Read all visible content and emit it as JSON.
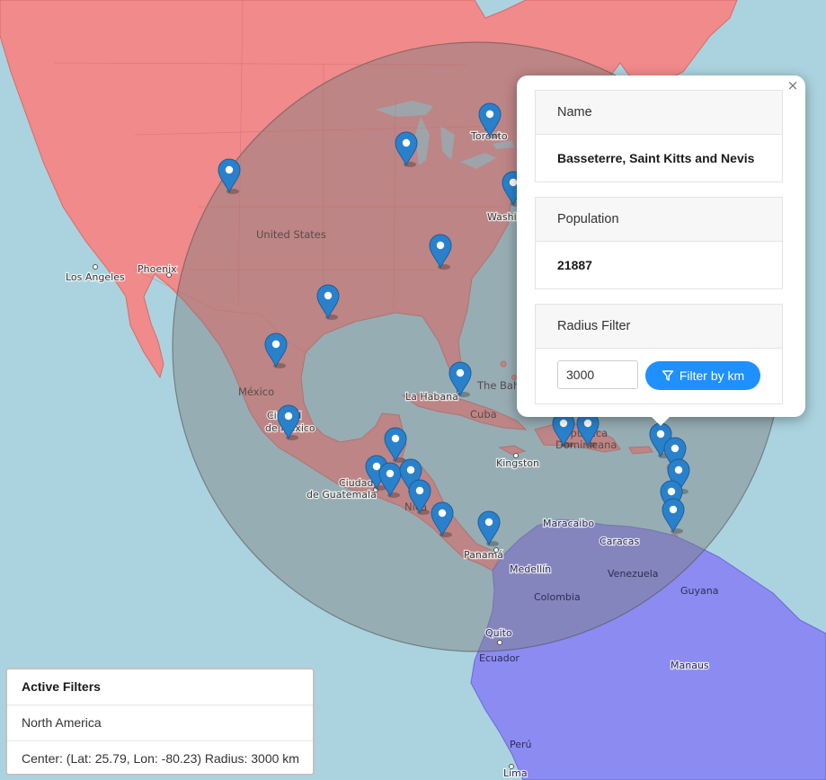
{
  "map": {
    "city_labels": [
      {
        "name": "Los Angeles"
      },
      {
        "name": "Phoenix"
      },
      {
        "name": "Toronto"
      },
      {
        "name": "Washi"
      },
      {
        "name": "La Habana"
      },
      {
        "name": "Kingston"
      },
      {
        "name": "Ciudad"
      },
      {
        "name": "de México"
      },
      {
        "name": "Ciudad"
      },
      {
        "name": "de Guatemala"
      },
      {
        "name": "Panamá"
      },
      {
        "name": "Maracaibo"
      },
      {
        "name": "Caracas"
      },
      {
        "name": "Medellín"
      },
      {
        "name": "Quito"
      },
      {
        "name": "Manaus"
      },
      {
        "name": "Lima"
      }
    ],
    "country_labels": [
      {
        "name": "United States"
      },
      {
        "name": "México"
      },
      {
        "name": "Cuba"
      },
      {
        "name": "The Bah"
      },
      {
        "name": "República"
      },
      {
        "name": "Dominicana"
      },
      {
        "name": "Nica"
      },
      {
        "name": "Venezuela"
      },
      {
        "name": "Colombia"
      },
      {
        "name": "Guyana"
      },
      {
        "name": "Ecuador"
      },
      {
        "name": "Perú"
      }
    ],
    "colors": {
      "water": "#aad3df",
      "north_america_fill": "#f18a8a",
      "south_america_fill": "#8b8bf2",
      "radius_circle": "#7f7f7f",
      "marker": "#2a81cb"
    }
  },
  "popup": {
    "close_label": "×",
    "name_header": "Name",
    "name_value": "Basseterre, Saint Kitts and Nevis",
    "population_header": "Population",
    "population_value": "21887",
    "radius_header": "Radius Filter",
    "radius_value": "3000",
    "filter_button_label": "Filter by km",
    "filter_icon": "funnel-icon"
  },
  "active_filters": {
    "title": "Active Filters",
    "region": "North America",
    "center_radius": "Center: (Lat: 25.79, Lon: -80.23) Radius: 3000 km"
  }
}
